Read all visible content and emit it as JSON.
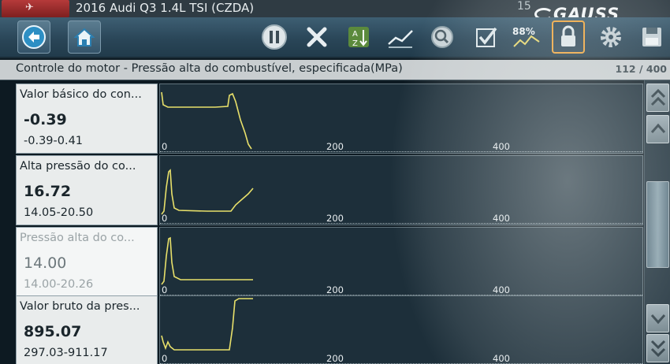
{
  "titlebar": {
    "vehicle_title": "2016 Audi Q3 1.4L TSI (CZDA)",
    "clock": "15",
    "brand": "GAUSS"
  },
  "toolbar": {
    "buttons": [
      {
        "name": "back",
        "icon": "back-arrow-icon"
      },
      {
        "name": "home",
        "icon": "home-icon"
      },
      {
        "name": "pause",
        "icon": "pause-icon"
      },
      {
        "name": "clear",
        "icon": "close-icon"
      },
      {
        "name": "sort",
        "icon": "sort-az-icon"
      },
      {
        "name": "graph",
        "icon": "graph-icon"
      },
      {
        "name": "zoom",
        "icon": "zoom-icon"
      },
      {
        "name": "select",
        "icon": "checkmark-icon"
      },
      {
        "name": "percent",
        "icon": "percent-88-icon",
        "text": "88%"
      },
      {
        "name": "lock",
        "icon": "lock-icon"
      },
      {
        "name": "settings",
        "icon": "gear-icon"
      },
      {
        "name": "save",
        "icon": "save-icon"
      }
    ]
  },
  "header": {
    "label": "Controle do motor - Pressão alta do combustível, especificada(MPa)",
    "count": "112 / 400"
  },
  "axis_ticks": [
    "0",
    "200",
    "400"
  ],
  "rows": [
    {
      "name": "Valor básico do con...",
      "value": "-0.39",
      "range": "-0.39-0.41",
      "dim": false
    },
    {
      "name": "Alta pressão do co...",
      "value": "16.72",
      "range": "14.05-20.50",
      "dim": false
    },
    {
      "name": "Pressão alta do co...",
      "value": "14.00",
      "range": "14.00-20.26",
      "dim": true
    },
    {
      "name": "Valor bruto da pres...",
      "value": "895.07",
      "range": "297.03-911.17",
      "dim": false
    }
  ],
  "colors": {
    "trace": "#e8e06a",
    "accent_lock": "#f0a53b",
    "header_bg": "#c9ced0"
  }
}
